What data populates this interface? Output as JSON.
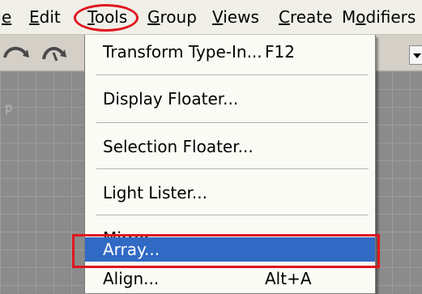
{
  "menubar": {
    "items": [
      {
        "id": "file",
        "prefix": "",
        "mnemonic": "e",
        "suffix": ""
      },
      {
        "id": "edit",
        "prefix": "",
        "mnemonic": "E",
        "suffix": "dit"
      },
      {
        "id": "tools",
        "prefix": "",
        "mnemonic": "T",
        "suffix": "ools"
      },
      {
        "id": "group",
        "prefix": "",
        "mnemonic": "G",
        "suffix": "roup"
      },
      {
        "id": "views",
        "prefix": "",
        "mnemonic": "V",
        "suffix": "iews"
      },
      {
        "id": "create",
        "prefix": "",
        "mnemonic": "C",
        "suffix": "reate"
      },
      {
        "id": "modifiers",
        "prefix": "M",
        "mnemonic": "o",
        "suffix": "difiers"
      }
    ]
  },
  "viewport": {
    "label": "p"
  },
  "tools_menu": {
    "items": [
      {
        "label": "Transform Type-In...",
        "shortcut": "F12"
      },
      {
        "label": "Display Floater...",
        "shortcut": ""
      },
      {
        "label": "Selection Floater...",
        "shortcut": ""
      },
      {
        "label": "Light Lister...",
        "shortcut": ""
      },
      {
        "label": "Mirror...",
        "shortcut": ""
      },
      {
        "label": "Array...",
        "shortcut": ""
      },
      {
        "label": "Align...",
        "shortcut": "Alt+A"
      }
    ],
    "highlighted": "Array..."
  },
  "colors": {
    "highlight": "#316ac5",
    "annotation_red": "#e0161e",
    "menu_bg": "#fbfbf6"
  },
  "icons": [
    "undo-icon",
    "redo-icon",
    "dropdown-arrow-icon"
  ]
}
